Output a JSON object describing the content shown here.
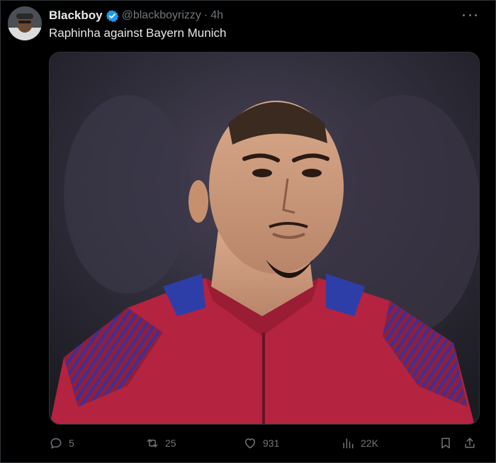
{
  "tweet": {
    "display_name": "Blackboy",
    "handle": "@blackboyrizzy",
    "separator": "·",
    "time": "4h",
    "text": "Raphinha against Bayern Munich",
    "verified": true
  },
  "actions": {
    "replies": "5",
    "reposts": "25",
    "likes": "931",
    "views": "22K"
  },
  "icons": {
    "verified": "verified-badge-icon",
    "more": "more-options-icon",
    "reply": "reply-icon",
    "repost": "repost-icon",
    "like": "heart-icon",
    "views": "views-chart-icon",
    "bookmark": "bookmark-icon",
    "share": "share-icon"
  },
  "colors": {
    "background": "#000000",
    "primary_text": "#e7e9ea",
    "secondary_text": "#71767b",
    "border": "#2f3336",
    "verified_blue": "#1d9bf0"
  }
}
